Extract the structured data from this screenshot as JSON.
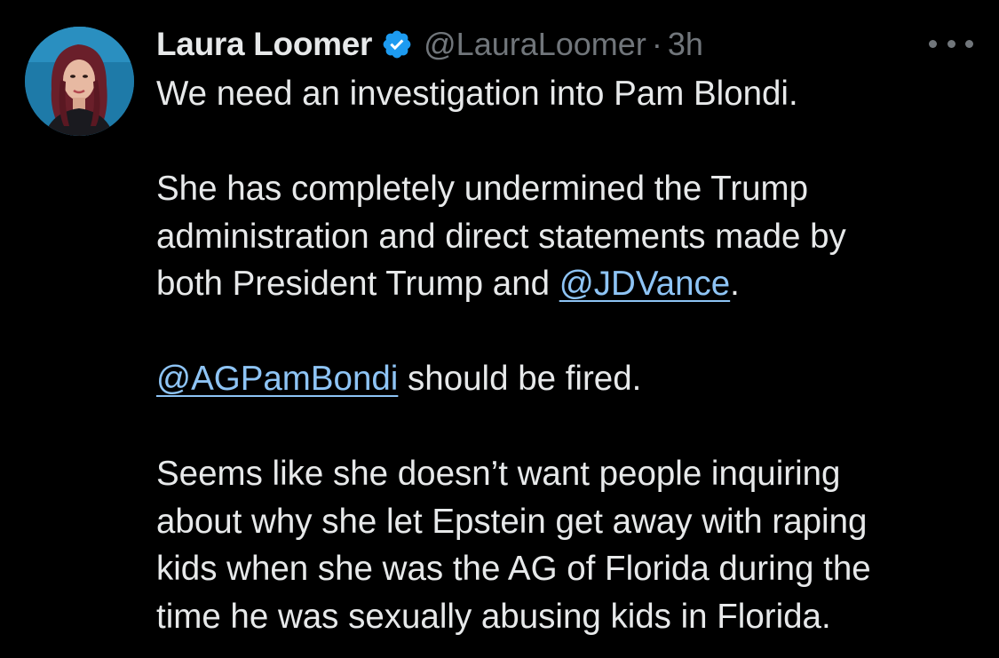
{
  "post": {
    "author": {
      "display_name": "Laura Loomer",
      "handle": "@LauraLoomer",
      "verified": true,
      "avatar_icon": "avatar-photo"
    },
    "separator": "·",
    "time_ago": "3h",
    "more_icon": "ellipsis-icon",
    "text": {
      "p1": "We need an investigation into Pam Blondi.",
      "p2_line1": "She has completely undermined the Trump",
      "p2_line2": "administration and direct statements made by",
      "p2_line3_prefix": "both President Trump and ",
      "mention_jdvance": "@JDVance",
      "p2_line3_suffix": ".",
      "mention_agpambondi": "@AGPamBondi",
      "p3_suffix": " should be fired.",
      "p4_line1": "Seems like she doesn’t want people inquiring",
      "p4_line2": "about why she let Epstein get away with raping",
      "p4_line3": "kids when she was the AG of Florida during the",
      "p4_line4": "time he was sexually abusing kids in Florida."
    }
  },
  "colors": {
    "background": "#000000",
    "primary_text": "#e7e9ea",
    "secondary_text": "#71767b",
    "mention": "#8ec4f5",
    "verified_badge": "#1d9bf0"
  }
}
